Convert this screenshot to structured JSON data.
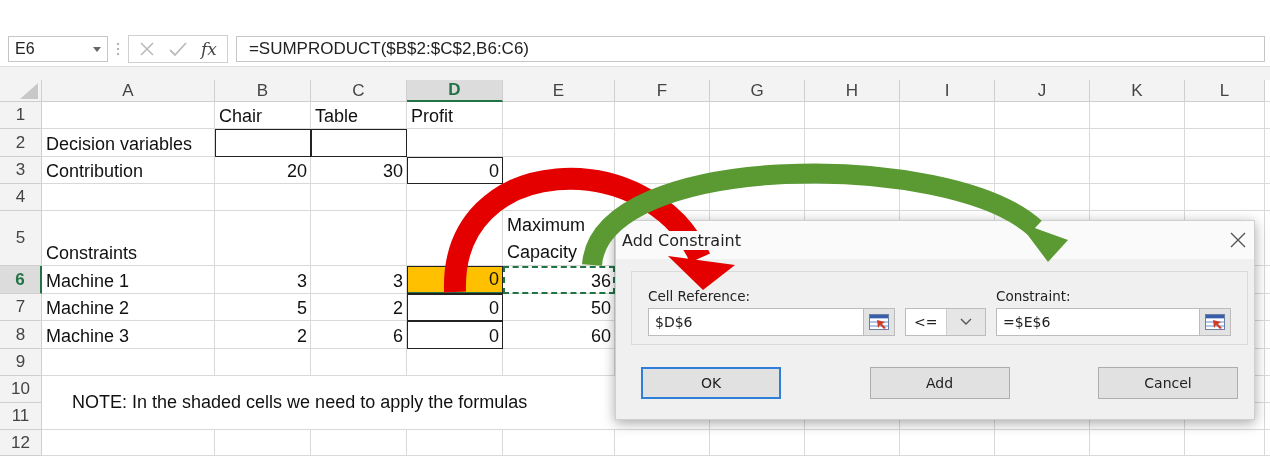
{
  "formula_bar": {
    "name_box": "E6",
    "fx": "fx",
    "formula": "=SUMPRODUCT($B$2:$C$2,B6:C6)"
  },
  "columns": [
    {
      "label": "A",
      "selected": false
    },
    {
      "label": "B",
      "selected": false
    },
    {
      "label": "C",
      "selected": false
    },
    {
      "label": "D",
      "selected": true
    },
    {
      "label": "E",
      "selected": false
    },
    {
      "label": "F",
      "selected": false
    },
    {
      "label": "G",
      "selected": false
    },
    {
      "label": "H",
      "selected": false
    },
    {
      "label": "I",
      "selected": false
    },
    {
      "label": "J",
      "selected": false
    },
    {
      "label": "K",
      "selected": false
    },
    {
      "label": "L",
      "selected": false
    }
  ],
  "rows": [
    {
      "number": "1",
      "selected": false,
      "cells": [
        {
          "text": "",
          "kind": "plain"
        },
        {
          "text": "Chair",
          "kind": "label"
        },
        {
          "text": "Table",
          "kind": "label"
        },
        {
          "text": "Profit",
          "kind": "label"
        }
      ]
    },
    {
      "number": "2",
      "selected": false,
      "cells": [
        {
          "text": "Decision variables",
          "kind": "label"
        },
        {
          "text": "",
          "kind": "boxed"
        },
        {
          "text": "",
          "kind": "boxed"
        }
      ]
    },
    {
      "number": "3",
      "selected": false,
      "cells": [
        {
          "text": "Contribution",
          "kind": "label"
        },
        {
          "text": "20",
          "kind": "number"
        },
        {
          "text": "30",
          "kind": "number"
        },
        {
          "text": "0",
          "kind": "boxed"
        }
      ]
    },
    {
      "number": "4",
      "selected": false,
      "cells": []
    },
    {
      "number": "5",
      "selected": false,
      "cells": [
        {
          "text": "Constraints",
          "kind": "label"
        },
        {
          "text": "",
          "kind": "plain"
        },
        {
          "text": "",
          "kind": "plain"
        },
        {
          "text": "",
          "kind": "plain"
        },
        {
          "text": "Maximum Capacity",
          "kind": "wrapped"
        }
      ]
    },
    {
      "number": "6",
      "selected": true,
      "cells": [
        {
          "text": "Machine 1",
          "kind": "label"
        },
        {
          "text": "3",
          "kind": "number"
        },
        {
          "text": "3",
          "kind": "number"
        },
        {
          "text": "0",
          "kind": "active"
        },
        {
          "text": "36",
          "kind": "marquee"
        }
      ]
    },
    {
      "number": "7",
      "selected": false,
      "cells": [
        {
          "text": "Machine 2",
          "kind": "label"
        },
        {
          "text": "5",
          "kind": "number"
        },
        {
          "text": "2",
          "kind": "number"
        },
        {
          "text": "0",
          "kind": "boxed"
        },
        {
          "text": "50",
          "kind": "number"
        }
      ]
    },
    {
      "number": "8",
      "selected": false,
      "cells": [
        {
          "text": "Machine 3",
          "kind": "label"
        },
        {
          "text": "2",
          "kind": "number"
        },
        {
          "text": "6",
          "kind": "number"
        },
        {
          "text": "0",
          "kind": "boxed"
        },
        {
          "text": "60",
          "kind": "number"
        }
      ]
    },
    {
      "number": "9",
      "selected": false,
      "cells": []
    },
    {
      "number": "10",
      "selected": false,
      "cells": []
    },
    {
      "number": "11",
      "selected": false,
      "cells": []
    },
    {
      "number": "12",
      "selected": false,
      "cells": []
    }
  ],
  "note": "NOTE: In the shaded cells we need to apply the formulas",
  "dialog": {
    "title": "Add Constraint",
    "cell_reference": {
      "label": "Cell Reference:",
      "value": "$D$6"
    },
    "operator": {
      "value": "<="
    },
    "constraint": {
      "label": "Constraint:",
      "value": "=$E$6"
    },
    "buttons": [
      {
        "label": "OK",
        "default": true
      },
      {
        "label": "Add",
        "default": false
      },
      {
        "label": "Cancel",
        "default": false
      }
    ]
  },
  "arrows": [
    {
      "color": "#e50000"
    },
    {
      "color": "#5b9a32"
    }
  ]
}
